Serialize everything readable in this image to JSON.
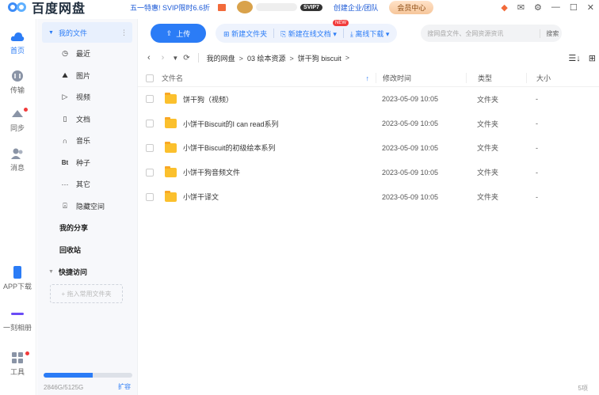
{
  "app": {
    "title": "百度网盘"
  },
  "topbar": {
    "promo": "五一特惠! SVIP限时6.6折",
    "svip_badge": "SVIP7",
    "create_team": "创建企业/团队",
    "member_center": "会员中心"
  },
  "rail": [
    {
      "label": "首页",
      "active": true
    },
    {
      "label": "传输",
      "active": false
    },
    {
      "label": "同步",
      "active": false
    },
    {
      "label": "消息",
      "active": false
    },
    {
      "label": "APP下载",
      "active": false
    },
    {
      "label": "一刻相册",
      "active": false
    },
    {
      "label": "工具",
      "active": false
    }
  ],
  "sidebar": {
    "my_files": "我的文件",
    "items": [
      {
        "icon": "clock-icon",
        "glyph": "◷",
        "label": "最近"
      },
      {
        "icon": "image-icon",
        "glyph": "⛰",
        "label": "图片"
      },
      {
        "icon": "video-icon",
        "glyph": "▷",
        "label": "视频"
      },
      {
        "icon": "doc-icon",
        "glyph": "▯",
        "label": "文档"
      },
      {
        "icon": "music-icon",
        "glyph": "∩",
        "label": "音乐"
      },
      {
        "icon": "torrent-icon",
        "glyph": "Bt",
        "label": "种子"
      },
      {
        "icon": "more-icon",
        "glyph": "···",
        "label": "其它"
      },
      {
        "icon": "lock-icon",
        "glyph": "⍓",
        "label": "隐藏空间"
      }
    ],
    "my_share": "我的分享",
    "recycle": "回收站",
    "quick_access": "快捷访问",
    "add_folder": "+ 拖入常用文件夹",
    "storage_text": "2846G/5125G",
    "storage_used": 0.555,
    "expand": "扩容"
  },
  "toolbar": {
    "upload": "上传",
    "new_folder": "新建文件夹",
    "new_online_doc": "新建在线文档",
    "new_badge": "NEW",
    "offline_download": "离线下载",
    "search_placeholder": "搜网盘文件、全网资源资讯",
    "search_button": "搜索"
  },
  "path": {
    "crumbs": [
      "我的网盘",
      "03 绘本资源",
      "饼干狗 biscuit"
    ]
  },
  "table": {
    "headers": {
      "name": "文件名",
      "time": "修改时间",
      "type": "类型",
      "size": "大小"
    },
    "rows": [
      {
        "name": "饼干狗（视频）",
        "time": "2023-05-09 10:05",
        "type": "文件夹",
        "size": "-"
      },
      {
        "name": "小饼干Biscuit的I can read系列",
        "time": "2023-05-09 10:05",
        "type": "文件夹",
        "size": "-"
      },
      {
        "name": "小饼干Biscuit的初级绘本系列",
        "time": "2023-05-09 10:05",
        "type": "文件夹",
        "size": "-"
      },
      {
        "name": "小饼干狗音频文件",
        "time": "2023-05-09 10:05",
        "type": "文件夹",
        "size": "-"
      },
      {
        "name": "小饼干译文",
        "time": "2023-05-09 10:05",
        "type": "文件夹",
        "size": "-"
      }
    ]
  },
  "status": {
    "count": "5项"
  }
}
